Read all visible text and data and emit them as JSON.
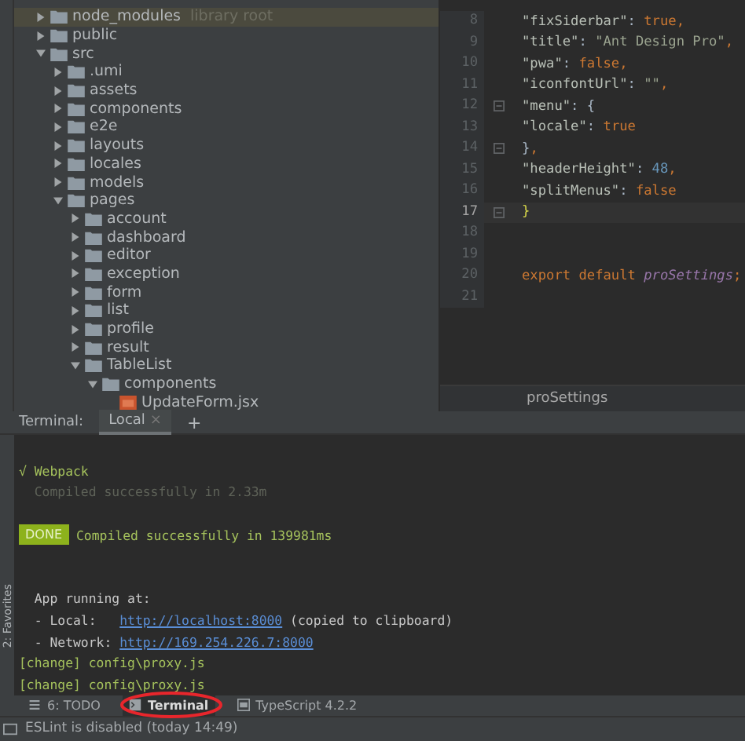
{
  "project_tree": [
    {
      "name": "node_modules",
      "kind": "folder",
      "expanded": false,
      "selected": true,
      "hint": "library root"
    },
    {
      "name": "public",
      "kind": "folder",
      "expanded": false,
      "selected": false
    },
    {
      "name": "src",
      "kind": "folder",
      "expanded": true,
      "selected": false,
      "children": [
        {
          "name": ".umi",
          "kind": "folder",
          "expanded": false,
          "selected": false
        },
        {
          "name": "assets",
          "kind": "folder",
          "expanded": false,
          "selected": false
        },
        {
          "name": "components",
          "kind": "folder",
          "expanded": false,
          "selected": false
        },
        {
          "name": "e2e",
          "kind": "folder",
          "expanded": false,
          "selected": false
        },
        {
          "name": "layouts",
          "kind": "folder",
          "expanded": false,
          "selected": false
        },
        {
          "name": "locales",
          "kind": "folder",
          "expanded": false,
          "selected": false
        },
        {
          "name": "models",
          "kind": "folder",
          "expanded": false,
          "selected": false
        },
        {
          "name": "pages",
          "kind": "folder",
          "expanded": true,
          "selected": false,
          "children": [
            {
              "name": "account",
              "kind": "folder",
              "expanded": false,
              "selected": false
            },
            {
              "name": "dashboard",
              "kind": "folder",
              "expanded": false,
              "selected": false
            },
            {
              "name": "editor",
              "kind": "folder",
              "expanded": false,
              "selected": false
            },
            {
              "name": "exception",
              "kind": "folder",
              "expanded": false,
              "selected": false
            },
            {
              "name": "form",
              "kind": "folder",
              "expanded": false,
              "selected": false
            },
            {
              "name": "list",
              "kind": "folder",
              "expanded": false,
              "selected": false
            },
            {
              "name": "profile",
              "kind": "folder",
              "expanded": false,
              "selected": false
            },
            {
              "name": "result",
              "kind": "folder",
              "expanded": false,
              "selected": false
            },
            {
              "name": "TableList",
              "kind": "folder",
              "expanded": true,
              "selected": false,
              "children": [
                {
                  "name": "components",
                  "kind": "folder",
                  "expanded": true,
                  "selected": false,
                  "children": [
                    {
                      "name": "UpdateForm.jsx",
                      "kind": "file",
                      "selected": false
                    }
                  ]
                }
              ]
            }
          ]
        }
      ]
    }
  ],
  "editor": {
    "lines": [
      {
        "number": "8",
        "fold": false,
        "current": false,
        "tokens": [
          {
            "kind": "key",
            "text": "\"fixSiderbar\""
          },
          {
            "kind": "punc",
            "text": ": "
          },
          {
            "kind": "kw",
            "text": "true"
          },
          {
            "kind": "kw",
            "text": ","
          }
        ]
      },
      {
        "number": "9",
        "fold": false,
        "current": false,
        "tokens": [
          {
            "kind": "key",
            "text": "\"title\""
          },
          {
            "kind": "punc",
            "text": ": "
          },
          {
            "kind": "str",
            "text": "\"Ant Design Pro\""
          },
          {
            "kind": "kw",
            "text": ","
          }
        ]
      },
      {
        "number": "10",
        "fold": false,
        "current": false,
        "tokens": [
          {
            "kind": "key",
            "text": "\"pwa\""
          },
          {
            "kind": "punc",
            "text": ": "
          },
          {
            "kind": "kw",
            "text": "false"
          },
          {
            "kind": "kw",
            "text": ","
          }
        ]
      },
      {
        "number": "11",
        "fold": false,
        "current": false,
        "tokens": [
          {
            "kind": "key",
            "text": "\"iconfontUrl\""
          },
          {
            "kind": "punc",
            "text": ": "
          },
          {
            "kind": "str",
            "text": "\"\""
          },
          {
            "kind": "kw",
            "text": ","
          }
        ]
      },
      {
        "number": "12",
        "fold": true,
        "current": false,
        "tokens": [
          {
            "kind": "key",
            "text": "\"menu\""
          },
          {
            "kind": "punc",
            "text": ": {"
          }
        ]
      },
      {
        "number": "13",
        "fold": false,
        "current": false,
        "tokens": [
          {
            "kind": "key",
            "text": "  \"locale\""
          },
          {
            "kind": "punc",
            "text": ": "
          },
          {
            "kind": "kw",
            "text": "true"
          }
        ]
      },
      {
        "number": "14",
        "fold": true,
        "current": false,
        "tokens": [
          {
            "kind": "punc",
            "text": "}"
          },
          {
            "kind": "kw",
            "text": ","
          }
        ]
      },
      {
        "number": "15",
        "fold": false,
        "current": false,
        "tokens": [
          {
            "kind": "key",
            "text": "\"headerHeight\""
          },
          {
            "kind": "punc",
            "text": ": "
          },
          {
            "kind": "num",
            "text": "48"
          },
          {
            "kind": "kw",
            "text": ","
          }
        ]
      },
      {
        "number": "16",
        "fold": false,
        "current": false,
        "tokens": [
          {
            "kind": "key",
            "text": "\"splitMenus\""
          },
          {
            "kind": "punc",
            "text": ": "
          },
          {
            "kind": "kw",
            "text": "false"
          }
        ]
      },
      {
        "number": "17",
        "fold": true,
        "current": true,
        "tokens": [
          {
            "kind": "brace",
            "text": "}"
          }
        ]
      },
      {
        "number": "18",
        "fold": false,
        "current": false
      },
      {
        "number": "19",
        "fold": false,
        "current": false
      },
      {
        "number": "20",
        "fold": false,
        "current": false,
        "tokens": [
          {
            "kind": "kw",
            "text": "export default "
          },
          {
            "kind": "fn",
            "text": "proSettings"
          },
          {
            "kind": "kw",
            "text": ";"
          }
        ]
      },
      {
        "number": "21",
        "fold": false,
        "current": false
      }
    ],
    "breadcrumb": "proSettings"
  },
  "terminal": {
    "title": "Terminal:",
    "tabs": [
      {
        "label": "Local",
        "close": "×",
        "selected": true
      }
    ],
    "add": "+",
    "lines": [
      {
        "kind": "blank"
      },
      {
        "kind": "success",
        "text": "√ Webpack"
      },
      {
        "kind": "dim",
        "text": "  Compiled successfully in 2.33m"
      },
      {
        "kind": "blank"
      },
      {
        "kind": "done",
        "badge": "DONE",
        "text": "Compiled successfully in 139981ms"
      },
      {
        "kind": "blank"
      },
      {
        "kind": "blank"
      },
      {
        "kind": "plain",
        "text": "  App running at:"
      },
      {
        "kind": "link",
        "text": "  - Local:   ",
        "link": "http://localhost:8000",
        "after": " (copied to clipboard)"
      },
      {
        "kind": "link",
        "text": "  - Network: ",
        "link": "http://169.254.226.7:8000"
      },
      {
        "kind": "success",
        "text": "[change] config\\proxy.js"
      },
      {
        "kind": "success",
        "text": "[change] config\\proxy.js"
      }
    ]
  },
  "side_stripe": {
    "label": "2: Favorites"
  },
  "tool_windows": [
    {
      "label": "6: TODO",
      "kind": "list",
      "selected": false
    },
    {
      "label": "Terminal",
      "kind": "terminal",
      "selected": true
    },
    {
      "label": "TypeScript 4.2.2",
      "kind": "ts",
      "selected": false
    }
  ],
  "status_bar": {
    "text": "ESLint is disabled (today 14:49)"
  }
}
